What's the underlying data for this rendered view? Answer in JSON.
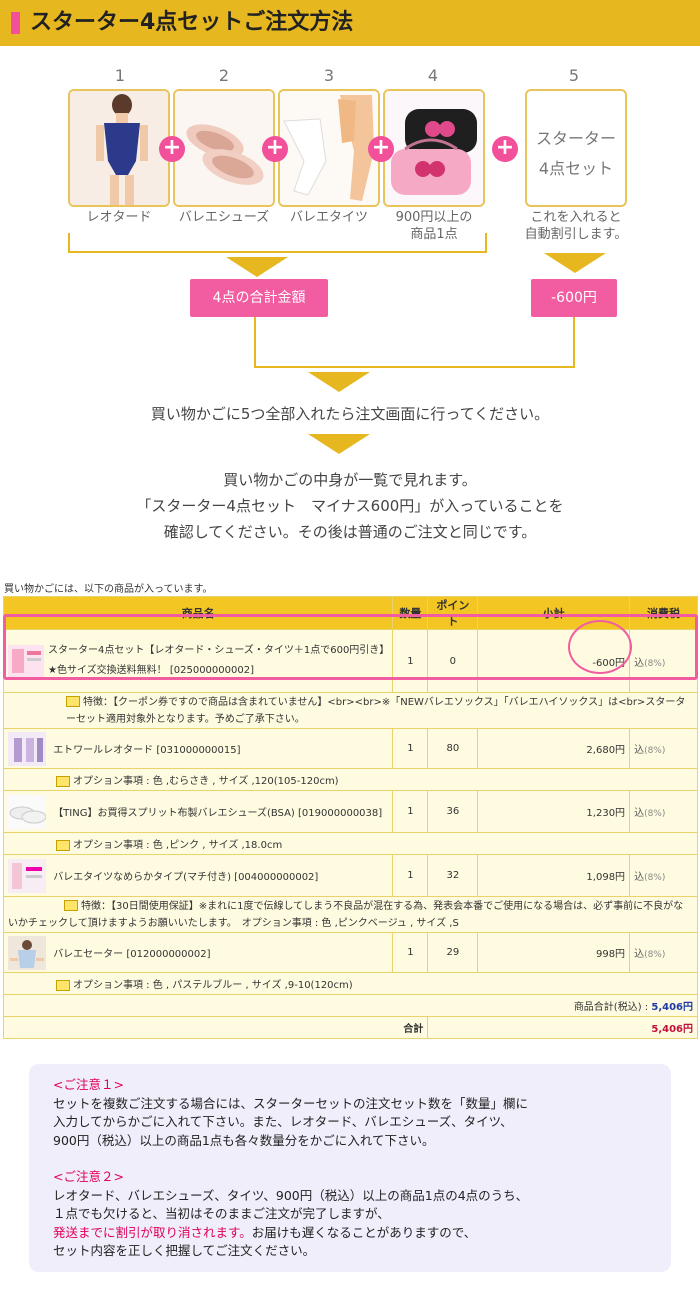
{
  "header": {
    "title": "スターター4点セットご注文方法"
  },
  "steps": [
    {
      "num": "1",
      "label": "レオタード"
    },
    {
      "num": "2",
      "label": "バレエシューズ"
    },
    {
      "num": "3",
      "label": "バレエタイツ"
    },
    {
      "num": "4",
      "label": "900円以上の\n商品1点"
    },
    {
      "num": "5",
      "label": "これを入れると\n自動割引します。"
    }
  ],
  "starter_box": {
    "line1": "スターター",
    "line2": "4点セット"
  },
  "plus_symbol": "+",
  "totals_button": "4点の合計金額",
  "discount_button": "-600円",
  "message1": "買い物かごに5つ全部入れたら注文画面に行ってください。",
  "message2": [
    "買い物かごの中身が一覧で見れます。",
    "「スターター4点セット　マイナス600円」が入っていることを",
    "確認してください。その後は普通のご注文と同じです。"
  ],
  "cart": {
    "intro": "買い物かごには、以下の商品が入っています。",
    "headers": [
      "商品名",
      "数量",
      "ポイント",
      "小計",
      "消費税"
    ],
    "rows": [
      {
        "name": "スターター4点セット【レオタード・シューズ・タイツ＋1点で600円引き】★色サイズ交換送料無料！ [025000000002]",
        "qty": "1",
        "points": "0",
        "subtotal": "-600円",
        "tax": "込",
        "tax_rate": "(8%)",
        "option": "特徴：【クーポン券ですので商品は含まれていません】<br><br>※「NEWバレエソックス」「バレエハイソックス」は<br>スターターセット適用対象外となります。予めご了承下さい。"
      },
      {
        "name": "エトワールレオタード [031000000015]",
        "qty": "1",
        "points": "80",
        "subtotal": "2,680円",
        "tax": "込",
        "tax_rate": "(8%)",
        "option": "オプション事項 : 色 ,むらさき , サイズ ,120(105-120cm)"
      },
      {
        "name": "【TING】お買得スプリット布製バレエシューズ(BSA) [019000000038]",
        "qty": "1",
        "points": "36",
        "subtotal": "1,230円",
        "tax": "込",
        "tax_rate": "(8%)",
        "option": "オプション事項 : 色 ,ピンク , サイズ ,18.0cm"
      },
      {
        "name": "バレエタイツなめらかタイプ(マチ付き) [004000000002]",
        "qty": "1",
        "points": "32",
        "subtotal": "1,098円",
        "tax": "込",
        "tax_rate": "(8%)",
        "option": "特徴：【30日間使用保証】※まれに1度で伝線してしまう不良品が混在する為、発表会本番でご使用になる場合は、必ず事前に不良がないかチェックして頂けますようお願いいたします。　オプション事項 : 色 ,ピンクベージュ , サイズ ,S"
      },
      {
        "name": "バレエセーター [012000000002]",
        "qty": "1",
        "points": "29",
        "subtotal": "998円",
        "tax": "込",
        "tax_rate": "(8%)",
        "option": "オプション事項 : 色 , パステルブルー , サイズ ,9-10(120cm)"
      }
    ],
    "product_total_label": "商品合計(税込) :",
    "product_total_value": "5,406円",
    "grand_total_label": "合計",
    "grand_total_value": "5,406円"
  },
  "notes": {
    "note1_title": "<ご注意１>",
    "note1_lines": [
      "セットを複数ご注文する場合には、スターターセットの注文セット数を「数量」欄に",
      "入力してからかごに入れて下さい。また、レオタード、バレエシューズ、タイツ、",
      "900円（税込）以上の商品1点も各々数量分をかごに入れて下さい。"
    ],
    "note2_title": "<ご注意２>",
    "note2_line1": "レオタード、バレエシューズ、タイツ、900円（税込）以上の商品1点の4点のうち、",
    "note2_line2": "１点でも欠けると、当初はそのままご注文が完了しますが、",
    "note2_pink": "発送までに割引が取り消されます。",
    "note2_line3_rest": "お届けも遅くなることがありますので、",
    "note2_line4": "セット内容を正しく把握してご注文ください。"
  },
  "colors": {
    "accent": "#e6b71e",
    "pink": "#f25ca0",
    "header_bg": "#f3c623"
  }
}
